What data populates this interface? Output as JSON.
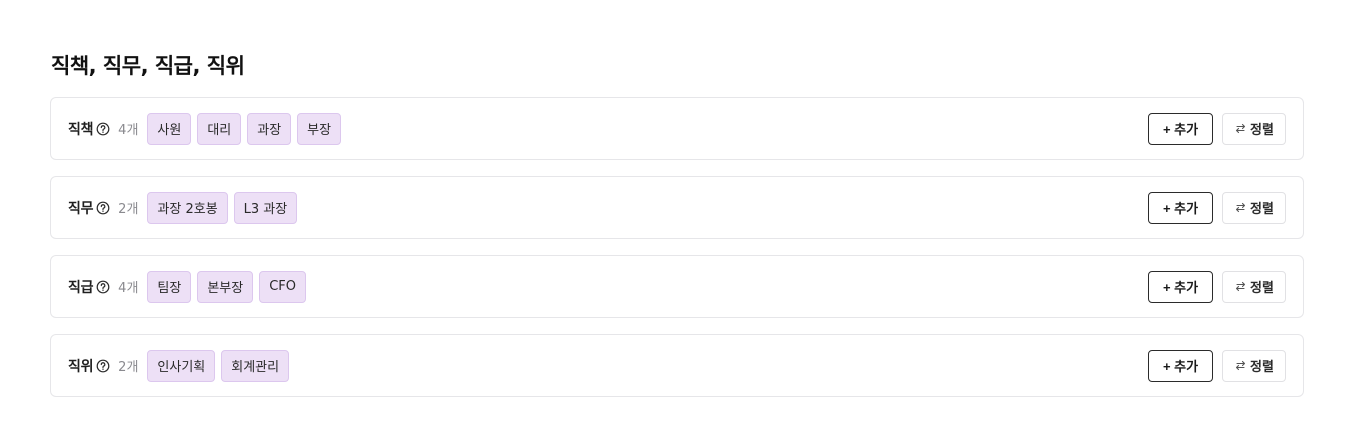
{
  "title": "직책, 직무, 직급, 직위",
  "rows": [
    {
      "label": "직책",
      "count": "4개",
      "tags": [
        "사원",
        "대리",
        "과장",
        "부장"
      ],
      "add_label": "+ 추가",
      "sort_label": "정렬"
    },
    {
      "label": "직무",
      "count": "2개",
      "tags": [
        "과장 2호봉",
        "L3 과장"
      ],
      "add_label": "+ 추가",
      "sort_label": "정렬"
    },
    {
      "label": "직급",
      "count": "4개",
      "tags": [
        "팀장",
        "본부장",
        "CFO"
      ],
      "add_label": "+ 추가",
      "sort_label": "정렬"
    },
    {
      "label": "직위",
      "count": "2개",
      "tags": [
        "인사기획",
        "회계관리"
      ],
      "add_label": "+ 추가",
      "sort_label": "정렬"
    }
  ],
  "icons": {
    "help": "help-circle-icon",
    "sort": "swap-arrows-icon"
  },
  "colors": {
    "tag_background": "#ede0f6",
    "tag_border": "#dcc7ee",
    "card_border": "#e6e6e9"
  }
}
